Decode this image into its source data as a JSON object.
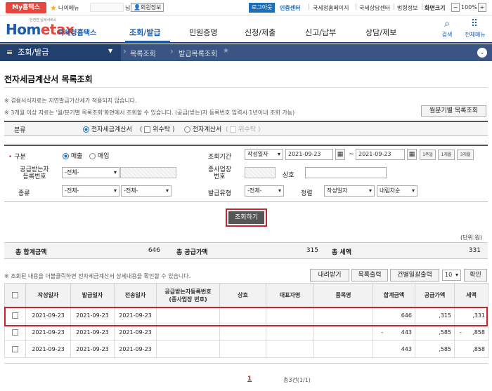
{
  "topbar": {
    "my_tab": "My홈택스",
    "my_menu": "나의메뉴",
    "name_suffix": "님",
    "member_info": "회원정보",
    "logout": "로그아웃",
    "cert_center": "인증센터",
    "links": [
      "국세청홈페이지",
      "국세상담센터",
      "법령정보"
    ],
    "screen_size_label": "화면크기",
    "zoom": "100%"
  },
  "header": {
    "logo_small": "안전한 납세서비스",
    "logo_hom": "Hom",
    "logo_tax": "etax",
    "logo_kr": "국세청홈택스",
    "gnb": [
      "조회/발급",
      "민원증명",
      "신청/제출",
      "신고/납부",
      "상담/제보"
    ],
    "search_label": "검색",
    "allmenu_label": "전체메뉴"
  },
  "nav": {
    "main": "조회/발급",
    "sub1": "목록조회",
    "sub2": "발급목록조회"
  },
  "page": {
    "title": "전자세금계산서 목록조회",
    "note1": "※ 겸용서식자료는 지연발급가산세가 적용되지 않습니다.",
    "note2": "※ 3개월 이상 자료는 '월/분기별 목록조회'화면에서 조회할 수 있습니다. (공급(받는)자 등록번호 입력시 1년이내 조회 가능)",
    "monthly_btn": "월분기별 목록조회"
  },
  "filter": {
    "category_label": "분류",
    "category_opt1": "전자세금계산서",
    "category_opt1_sub": "위수탁",
    "category_opt2": "전자계산서",
    "category_opt2_sub": "위수탁",
    "gubun_label": "구분",
    "gubun_sell": "매출",
    "gubun_buy": "매입",
    "period_label": "조회기간",
    "period_type": "작성일자",
    "date_from": "2021-09-23",
    "date_to": "2021-09-23",
    "period_btns": [
      "1주일",
      "1개월",
      "3개월"
    ],
    "receiver_label_1": "공급받는자",
    "receiver_label_2": "등록번호",
    "receiver_select": "-전체-",
    "branch_label_1": "종사업장",
    "branch_label_2": "번호",
    "company_label": "상호",
    "kind_label": "종류",
    "kind_select1": "-전체-",
    "kind_select2": "-전체-",
    "issue_type_label": "발급유형",
    "issue_type_select": "-전체-",
    "sort_label": "정렬",
    "sort_field": "작성일자",
    "sort_order": "내림차순",
    "search_btn": "조회하기"
  },
  "summary": {
    "unit": "(단위:원)",
    "total_label": "총 합계금액",
    "total_value": "646",
    "supply_label": "총 공급가액",
    "supply_value": "315",
    "tax_label": "총 세액",
    "tax_value": "331"
  },
  "list": {
    "note": "※ 조회된 내용을 더블클릭하면 전자세금계산서 상세내용을 확인할 수 있습니다.",
    "download_btn": "내려받기",
    "print_btn": "목록출력",
    "batch_print_btn": "건별일괄출력",
    "page_size": "10",
    "confirm_btn": "확인",
    "headers": [
      "작성일자",
      "발급일자",
      "전송일자",
      "공급받는자등록번호\n(종사업장 번호)",
      "상호",
      "대표자명",
      "품목명",
      "합계금액",
      "공급가액",
      "세액"
    ],
    "rows": [
      {
        "write": "2021-09-23",
        "issue": "2021-09-23",
        "send": "2021-09-23",
        "reg": "",
        "company": "",
        "ceo": "",
        "item": "",
        "total": "646",
        "supply": ",315",
        "tax": ",331"
      },
      {
        "write": "2021-09-23",
        "issue": "2021-09-23",
        "send": "2021-09-23",
        "reg": "",
        "company": "",
        "ceo": "",
        "item": "",
        "total": "-          443",
        "supply": ",585",
        "tax": "-      ,858"
      },
      {
        "write": "2021-09-23",
        "issue": "2021-09-23",
        "send": "2021-09-23",
        "reg": "",
        "company": "",
        "ceo": "",
        "item": "",
        "total": "443",
        "supply": ",585",
        "tax": ",858"
      }
    ]
  },
  "pagination": {
    "current": "1",
    "total": "총3건(1/1)"
  }
}
